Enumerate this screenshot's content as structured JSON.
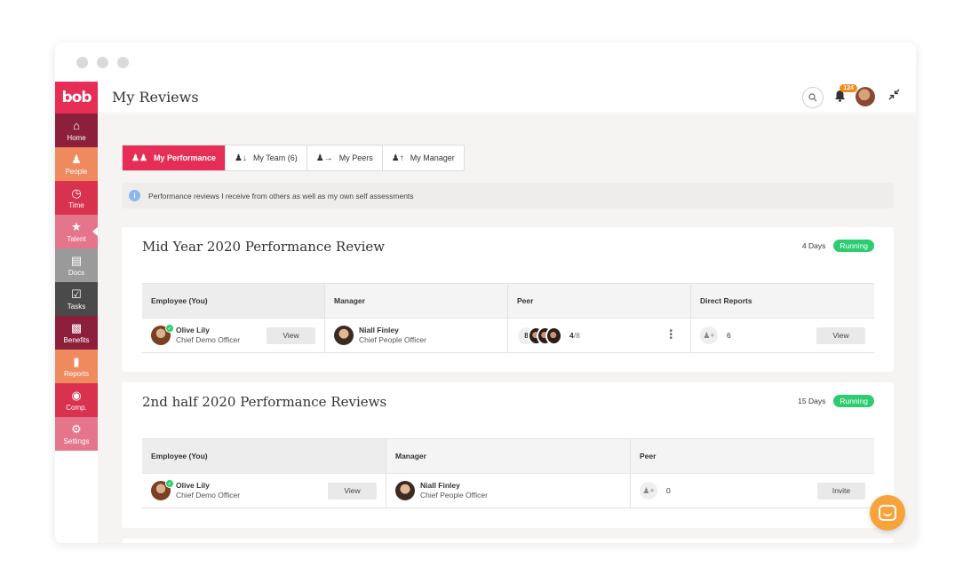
{
  "header": {
    "title": "My Reviews",
    "notification_count": "124"
  },
  "sidebar": {
    "logo": "bob",
    "items": [
      {
        "label": "Home",
        "icon": "home-icon",
        "color": "#8c1f3c"
      },
      {
        "label": "People",
        "icon": "people-icon",
        "color": "#ef8a5f"
      },
      {
        "label": "Time",
        "icon": "clock-icon",
        "color": "#d9324e"
      },
      {
        "label": "Talent",
        "icon": "talent-icon",
        "color": "#e5758b"
      },
      {
        "label": "Docs",
        "icon": "docs-icon",
        "color": "#9a9a9a"
      },
      {
        "label": "Tasks",
        "icon": "tasks-icon",
        "color": "#4a4a4a"
      },
      {
        "label": "Benefits",
        "icon": "gift-icon",
        "color": "#8c1f3c"
      },
      {
        "label": "Reports",
        "icon": "chart-icon",
        "color": "#ef8a5f"
      },
      {
        "label": "Comp.",
        "icon": "money-icon",
        "color": "#d9324e"
      },
      {
        "label": "Settings",
        "icon": "gear-icon",
        "color": "#e5758b"
      }
    ]
  },
  "tabs": [
    {
      "label": "My Performance",
      "icon": "people-icon"
    },
    {
      "label": "My Team (6)",
      "icon": "team-icon"
    },
    {
      "label": "My Peers",
      "icon": "peers-icon"
    },
    {
      "label": "My Manager",
      "icon": "manager-icon"
    }
  ],
  "info_text": "Performance reviews I receive from others as well as my own self assessments",
  "reviews": [
    {
      "title": "Mid Year 2020 Performance Review",
      "days": "4 Days",
      "status": "Running",
      "columns": [
        "Employee (You)",
        "Manager",
        "Peer",
        "Direct Reports"
      ],
      "employee": {
        "name": "Olive Lily",
        "role": "Chief Demo Officer",
        "action": "View"
      },
      "manager": {
        "name": "Niall Finley",
        "role": "Chief People Officer"
      },
      "peer": {
        "count": "8",
        "done": "4",
        "total": "/8"
      },
      "direct_reports": {
        "count": "6",
        "action": "View"
      }
    },
    {
      "title": "2nd half 2020 Performance Reviews",
      "days": "15 Days",
      "status": "Running",
      "columns": [
        "Employee (You)",
        "Manager",
        "Peer"
      ],
      "employee": {
        "name": "Olive Lily",
        "role": "Chief Demo Officer",
        "action": "View"
      },
      "manager": {
        "name": "Niall Finley",
        "role": "Chief People Officer"
      },
      "peer": {
        "count": "0",
        "action": "Invite"
      }
    }
  ],
  "colors": {
    "brand": "#e52d56",
    "running": "#2ecc71",
    "chat": "#f7a33c"
  }
}
